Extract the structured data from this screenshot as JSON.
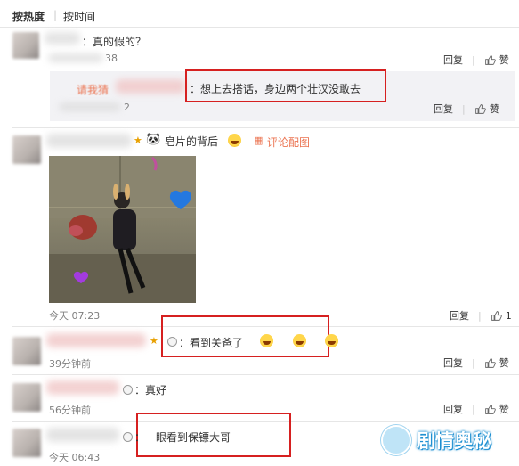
{
  "sort": {
    "hot_label": "按热度",
    "separator": "|",
    "time_label": "按时间"
  },
  "comments": [
    {
      "text": "：真的假的？",
      "partial_time": "38",
      "like_label": "赞",
      "reply_label": "回复"
    },
    {
      "reply_prefix": "请我猜",
      "text": "：想上去搭话，身边两个壮汉没敢去",
      "partial_time": "2",
      "like_label": "赞",
      "reply_label": "回复"
    },
    {
      "text": "皂片的背后",
      "pic_link": "评论配图",
      "time": "今天 07:23",
      "reply_label": "回复",
      "like_count": "1"
    },
    {
      "text": "：看到关爸了",
      "time": "39分钟前",
      "reply_label": "回复",
      "like_label": "赞"
    },
    {
      "text": "：真好",
      "time": "56分钟前",
      "reply_label": "回复",
      "like_label": "赞"
    },
    {
      "text": "：一眼看到保镖大哥",
      "time": "今天 06:43"
    }
  ],
  "watermark": {
    "text": "剧情奥秘"
  },
  "colors": {
    "highlight_box": "#d62020",
    "link": "#eb7350",
    "reply_bg": "#f2f2f5"
  }
}
